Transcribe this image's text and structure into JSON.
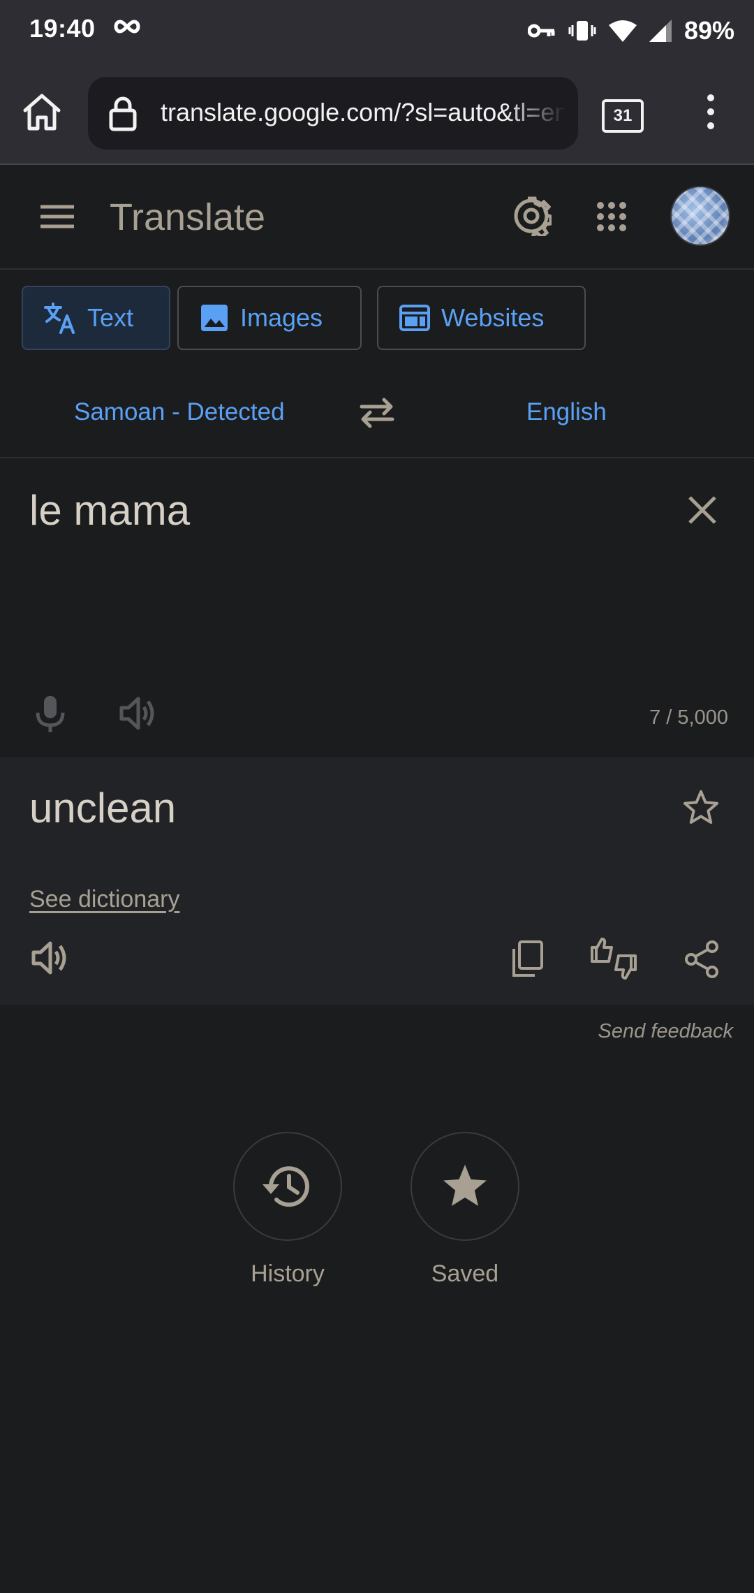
{
  "status_bar": {
    "time": "19:40",
    "battery": "89%"
  },
  "browser": {
    "url": "translate.google.com/?sl=auto&tl=en",
    "tab_count": "31"
  },
  "header": {
    "title": "Translate"
  },
  "modes": [
    {
      "label": "Text",
      "active": true
    },
    {
      "label": "Images",
      "active": false
    },
    {
      "label": "Websites",
      "active": false
    }
  ],
  "languages": {
    "source": "Samoan - Detected",
    "target": "English"
  },
  "input": {
    "text": "le mama",
    "char_count": "7 / 5,000"
  },
  "output": {
    "text": "unclean",
    "dictionary_link": "See dictionary"
  },
  "feedback_link": "Send feedback",
  "bottom": {
    "history_label": "History",
    "saved_label": "Saved"
  },
  "colors": {
    "accent": "#5aa0f4",
    "background": "#1b1c1e",
    "output_bg": "#222326",
    "text_muted": "#a8a193"
  },
  "icons": [
    "home-icon",
    "lock-icon",
    "more-vert-icon",
    "menu-icon",
    "settings-icon",
    "apps-grid-icon",
    "translate-icon",
    "image-icon",
    "web-icon",
    "swap-icon",
    "close-icon",
    "mic-icon",
    "volume-icon",
    "star-outline-icon",
    "copy-icon",
    "thumbs-icon",
    "share-icon",
    "history-icon",
    "star-icon"
  ]
}
